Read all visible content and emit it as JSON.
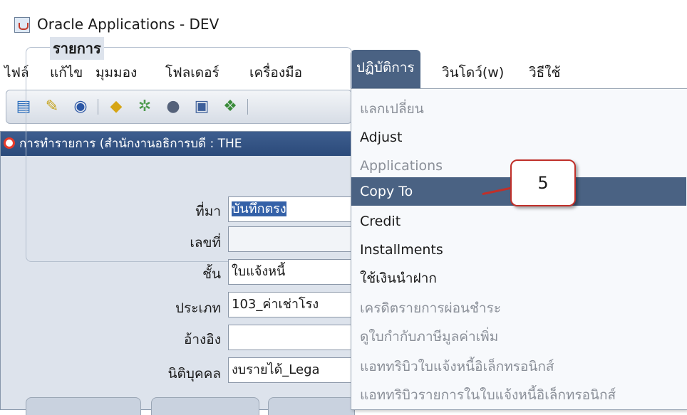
{
  "window": {
    "title": "Oracle Applications - DEV"
  },
  "menubar": {
    "items": [
      "ไฟล์",
      "แก้ไข",
      "มุมมอง",
      "โฟลเดอร์",
      "เครื่องมือ",
      "ปฏิบัติการ",
      "วินโดว์(w)",
      "วิธีใช้"
    ],
    "active": "ปฏิบัติการ"
  },
  "toolbar": {
    "icons": [
      "new-record-icon",
      "find-icon",
      "navigator-icon",
      "save-icon",
      "next-step-icon",
      "switch-responsibility-icon",
      "print-icon",
      "close-form-icon"
    ]
  },
  "form": {
    "title": "การทำรายการ (สำนักงานอธิการบดี : THE",
    "group_title": "รายการ",
    "fields": [
      {
        "label": "ที่มา",
        "value": "บันทึกตรง"
      },
      {
        "label": "เลขที่",
        "value": ""
      },
      {
        "label": "ชั้น",
        "value": "ใบแจ้งหนี้"
      },
      {
        "label": "ประเภท",
        "value": "103_ค่าเช่าโรง"
      },
      {
        "label": "อ้างอิง",
        "value": ""
      },
      {
        "label": "นิติบุคคล",
        "value": "งบรายได้_Lega"
      }
    ]
  },
  "dropdown": {
    "items": [
      {
        "label": "แลกเปลี่ยน",
        "enabled": false
      },
      {
        "label": "Adjust",
        "enabled": true
      },
      {
        "label": "Applications",
        "enabled": false
      },
      {
        "label": "Copy To",
        "enabled": true
      },
      {
        "label": "Credit",
        "enabled": true
      },
      {
        "label": "Installments",
        "enabled": true
      },
      {
        "label": "ใช้เงินนำฝาก",
        "enabled": true
      },
      {
        "label": "เครดิตรายการผ่อนชำระ",
        "enabled": false
      },
      {
        "label": "ดูใบกำกับภาษีมูลค่าเพิ่ม",
        "enabled": false
      },
      {
        "label": "แอททริบิวใบแจ้งหนี้อิเล็กทรอนิกส์",
        "enabled": false
      },
      {
        "label": "แอททริบิวรายการในใบแจ้งหนี้อิเล็กทรอนิกส์",
        "enabled": false
      }
    ],
    "highlighted": "Copy To"
  },
  "callout": {
    "number": "5"
  },
  "colors": {
    "menu_active": "#4a6283",
    "callout_border": "#c0302a",
    "window_title": "#2b4a7a"
  }
}
